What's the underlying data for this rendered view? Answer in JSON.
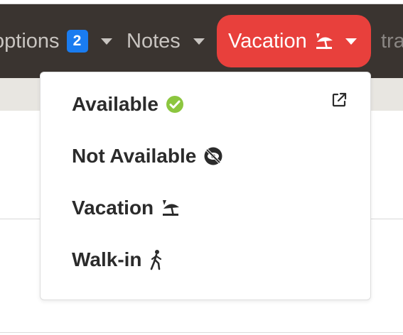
{
  "navbar": {
    "options": {
      "label": "options",
      "badge": "2"
    },
    "notes": {
      "label": "Notes"
    },
    "vacation": {
      "label": "Vacation",
      "icon": "umbrella-beach-icon",
      "bg_color": "#e8403c"
    },
    "extra": {
      "label": "tra"
    }
  },
  "dropdown": {
    "external_icon": "external-link-icon",
    "items": [
      {
        "label": "Available",
        "icon": "check-circle-icon",
        "icon_color": "#8cc63f"
      },
      {
        "label": "Not Available",
        "icon": "eye-slash-circle-icon"
      },
      {
        "label": "Vacation",
        "icon": "umbrella-beach-icon"
      },
      {
        "label": "Walk-in",
        "icon": "walking-person-icon"
      }
    ]
  },
  "colors": {
    "navbar_bg": "#3a3430",
    "badge_bg": "#1a7cf0",
    "active_bg": "#e8403c",
    "subbar_bg": "#e8e6e1"
  }
}
